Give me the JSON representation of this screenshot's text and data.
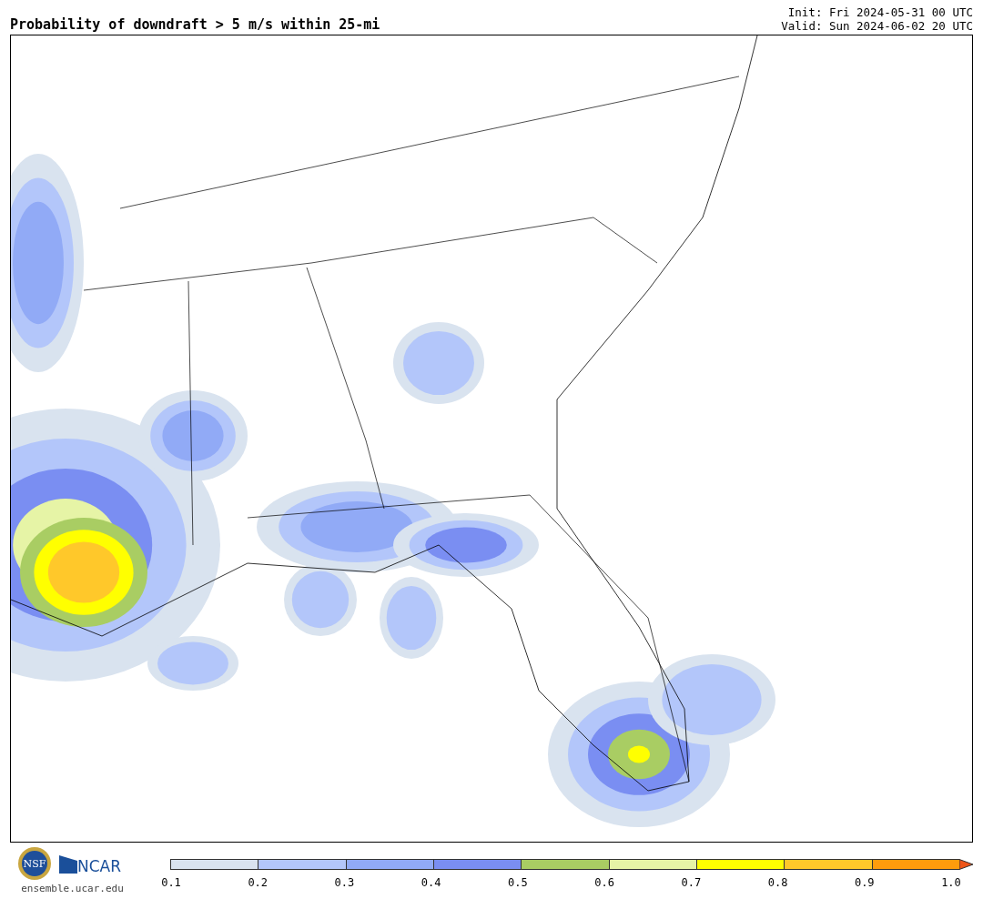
{
  "title": "Probability of downdraft > 5 m/s within 25-mi",
  "init": "Init: Fri 2024-05-31 00 UTC",
  "valid": "Valid: Sun 2024-06-02 20 UTC",
  "logos": {
    "nsf": "NSF",
    "ncar": "NCAR",
    "url": "ensemble.ucar.edu"
  },
  "colorbar": {
    "bins": [
      {
        "color": "#d9e3ef"
      },
      {
        "color": "#b3c6fa"
      },
      {
        "color": "#91aaf6"
      },
      {
        "color": "#7a8ef2"
      },
      {
        "color": "#a9cd63"
      },
      {
        "color": "#e6f4a6"
      },
      {
        "color": "#ffff00"
      },
      {
        "color": "#ffc82a"
      },
      {
        "color": "#ff9c0c"
      }
    ],
    "extend": {
      "color": "#ee5417"
    },
    "ticks": [
      "0.1",
      "0.2",
      "0.3",
      "0.4",
      "0.5",
      "0.6",
      "0.7",
      "0.8",
      "0.9",
      "1.0"
    ]
  }
}
